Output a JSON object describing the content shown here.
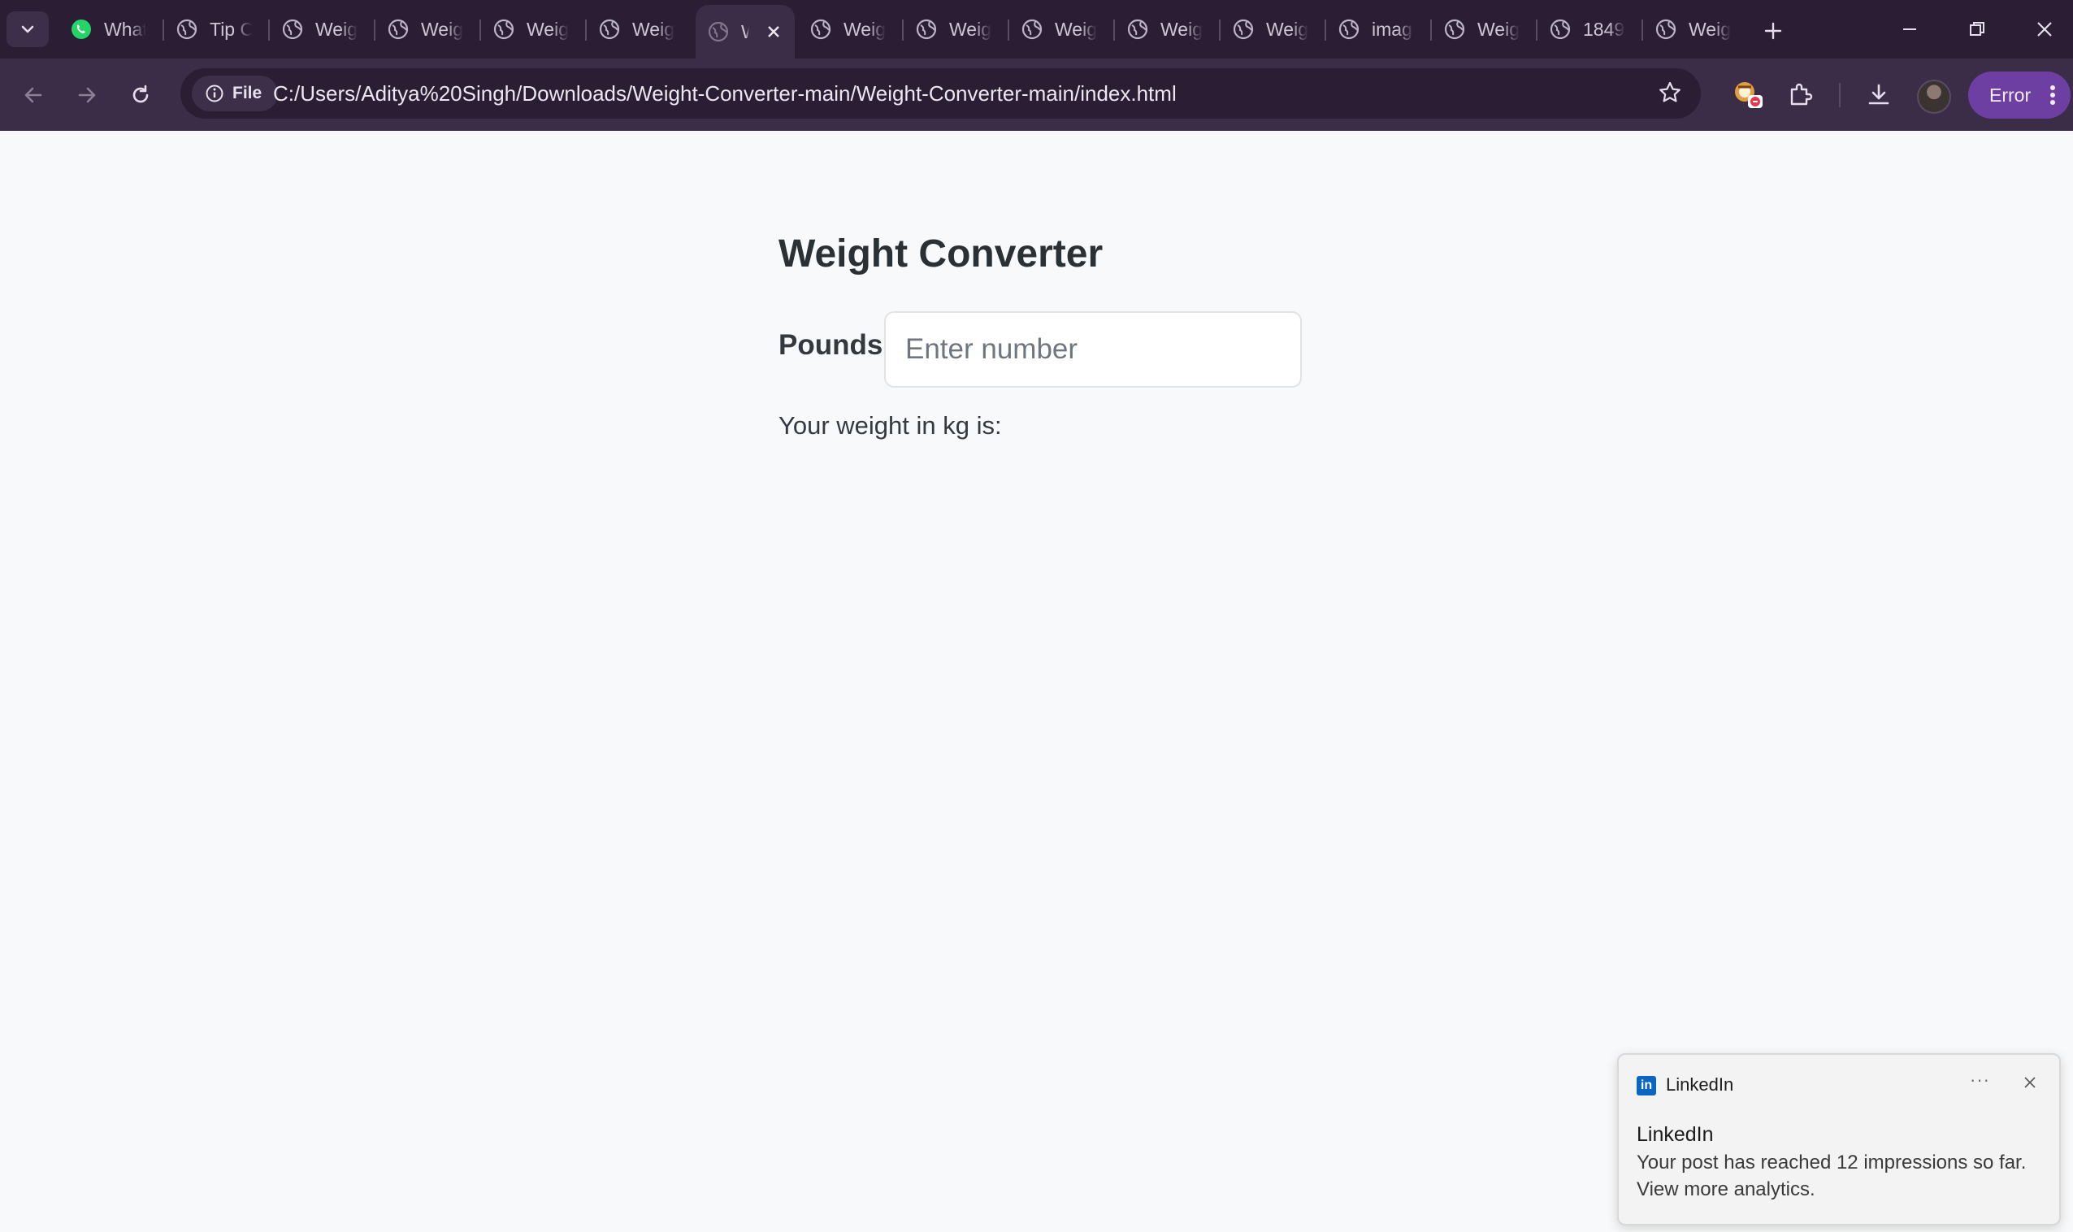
{
  "browser": {
    "tabs": [
      {
        "title": "What",
        "icon": "whatsapp-icon"
      },
      {
        "title": "Tip C",
        "icon": "globe-icon"
      },
      {
        "title": "Weig",
        "icon": "globe-icon"
      },
      {
        "title": "Weig",
        "icon": "globe-icon"
      },
      {
        "title": "Weig",
        "icon": "globe-icon"
      },
      {
        "title": "Weig",
        "icon": "globe-icon"
      },
      {
        "title": "W",
        "icon": "globe-icon",
        "active": true
      },
      {
        "title": "Weig",
        "icon": "globe-icon"
      },
      {
        "title": "Weig",
        "icon": "globe-icon"
      },
      {
        "title": "Weig",
        "icon": "globe-icon"
      },
      {
        "title": "Weig",
        "icon": "globe-icon"
      },
      {
        "title": "Weig",
        "icon": "globe-icon"
      },
      {
        "title": "imag",
        "icon": "globe-icon"
      },
      {
        "title": "Weig",
        "icon": "globe-icon"
      },
      {
        "title": "1849",
        "icon": "globe-icon"
      },
      {
        "title": "Weig",
        "icon": "globe-icon"
      }
    ],
    "address_chip": "File",
    "url": "C:/Users/Aditya%20Singh/Downloads/Weight-Converter-main/Weight-Converter-main/index.html",
    "profile_status": "Error",
    "colors": {
      "frame": "#2a1d34",
      "toolbar": "#3b2c47",
      "error_chip": "#6e3fa3"
    }
  },
  "page": {
    "title": "Weight Converter",
    "pounds_label": "Pounds:",
    "input_placeholder": "Enter number",
    "input_value": "",
    "result_label": "Your weight in kg is:"
  },
  "notification": {
    "app_name": "LinkedIn",
    "title": "LinkedIn",
    "body": "Your post has reached 12 impressions so far. View more analytics.",
    "brand_color": "#0a66c2"
  }
}
